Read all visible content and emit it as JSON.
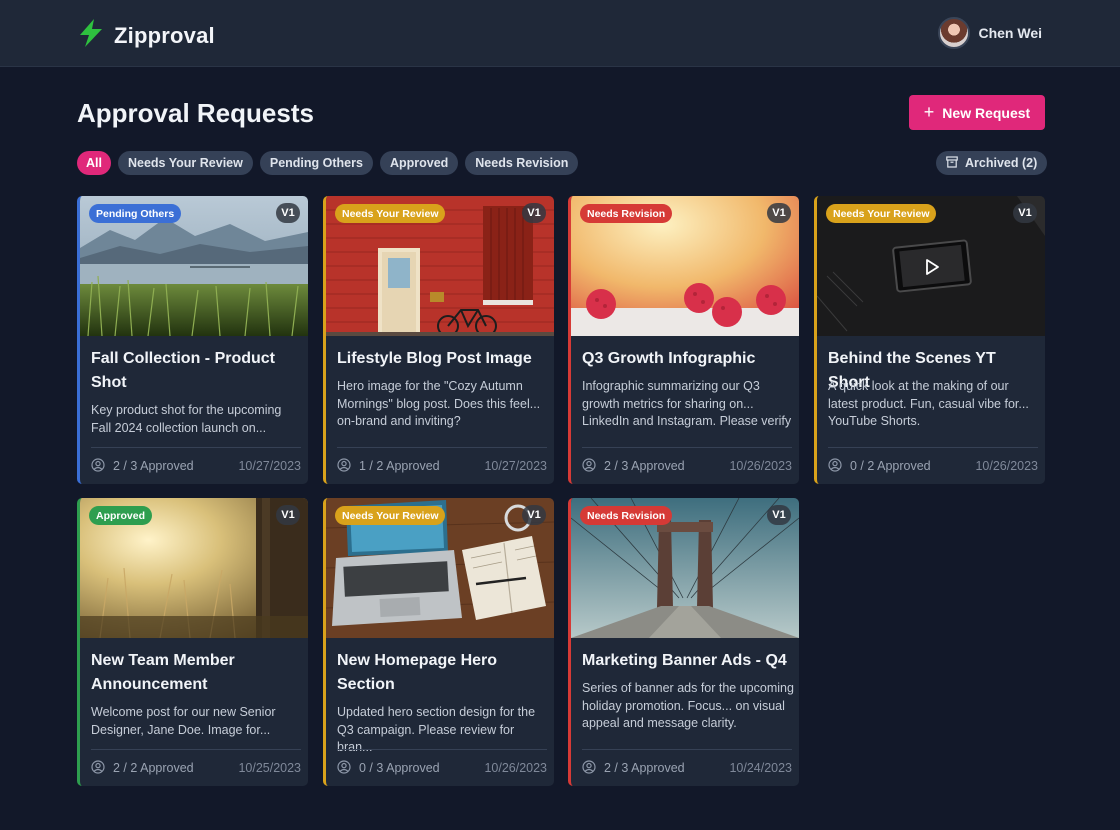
{
  "app": {
    "name": "Zipproval"
  },
  "user": {
    "name": "Chen Wei"
  },
  "page": {
    "title": "Approval Requests",
    "new_request_label": "New Request"
  },
  "filters": [
    {
      "label": "All",
      "active": true
    },
    {
      "label": "Needs Your Review",
      "active": false
    },
    {
      "label": "Pending Others",
      "active": false
    },
    {
      "label": "Approved",
      "active": false
    },
    {
      "label": "Needs Revision",
      "active": false
    }
  ],
  "archived_label": "Archived (2)",
  "status_colors": {
    "Pending Others": "#3b6fd6",
    "Needs Your Review": "#d9a21b",
    "Needs Revision": "#d63a36",
    "Approved": "#2e9e4f"
  },
  "cards": [
    {
      "status": "Pending Others",
      "version": "V1",
      "title": "Fall Collection - Product Shot",
      "description": "Key product shot for the upcoming Fall 2024 collection launch on...",
      "approved": "2 / 3 Approved",
      "date": "10/27/2023",
      "thumb": "lake-landscape"
    },
    {
      "status": "Needs Your Review",
      "version": "V1",
      "title": "Lifestyle Blog Post Image",
      "description": "Hero image for the \"Cozy Autumn Mornings\" blog post. Does this feel... on-brand and inviting?",
      "approved": "1 / 2 Approved",
      "date": "10/27/2023",
      "thumb": "red-wall-bicycle"
    },
    {
      "status": "Needs Revision",
      "version": "V1",
      "title": "Q3 Growth Infographic",
      "description": "Infographic summarizing our Q3 growth metrics for sharing on... LinkedIn and Instagram. Please verify data and design.",
      "approved": "2 / 3 Approved",
      "date": "10/26/2023",
      "thumb": "raspberries"
    },
    {
      "status": "Needs Your Review",
      "version": "V1",
      "title": "Behind the Scenes YT Short",
      "description": "A quick look at the making of our latest product. Fun, casual vibe for... YouTube Shorts.",
      "approved": "0 / 2 Approved",
      "date": "10/26/2023",
      "thumb": "video-desk",
      "video": true
    },
    {
      "status": "Approved",
      "version": "V1",
      "title": "New Team Member Announcement",
      "description": "Welcome post for our new Senior Designer, Jane Doe. Image for...",
      "approved": "2 / 2 Approved",
      "date": "10/25/2023",
      "thumb": "sunlit-grass"
    },
    {
      "status": "Needs Your Review",
      "version": "V1",
      "title": "New Homepage Hero Section",
      "description": "Updated hero section design for the Q3 campaign. Please review for bran...",
      "approved": "0 / 3 Approved",
      "date": "10/26/2023",
      "thumb": "laptop-desk"
    },
    {
      "status": "Needs Revision",
      "version": "V1",
      "title": "Marketing Banner Ads - Q4",
      "description": "Series of banner ads for the upcoming holiday promotion. Focus... on visual appeal and message clarity.",
      "approved": "2 / 3 Approved",
      "date": "10/24/2023",
      "thumb": "bridge"
    }
  ]
}
